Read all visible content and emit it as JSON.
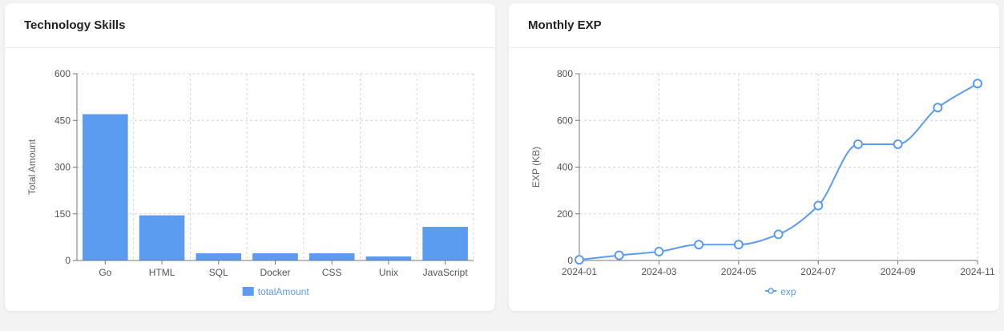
{
  "colors": {
    "accent": "#5b9cf0",
    "background": "#f3f3f3",
    "card": "#ffffff"
  },
  "cards": [
    {
      "title": "Technology Skills"
    },
    {
      "title": "Monthly EXP"
    }
  ],
  "chart_data": [
    {
      "type": "bar",
      "title": "Technology Skills",
      "categories": [
        "Go",
        "HTML",
        "SQL",
        "Docker",
        "CSS",
        "Unix",
        "JavaScript"
      ],
      "series": [
        {
          "name": "totalAmount",
          "values": [
            470,
            145,
            23,
            23,
            23,
            13,
            108
          ]
        }
      ],
      "ylabel": "Total Amount",
      "xlabel": "",
      "ylim": [
        0,
        600
      ],
      "yticks": [
        0,
        150,
        300,
        450,
        600
      ],
      "grid": true,
      "legend": "bottom-center"
    },
    {
      "type": "line",
      "title": "Monthly EXP",
      "x": [
        "2024-01",
        "2024-02",
        "2024-03",
        "2024-04",
        "2024-05",
        "2024-06",
        "2024-07",
        "2024-08",
        "2024-09",
        "2024-10",
        "2024-11"
      ],
      "xticks": [
        "2024-01",
        "2024-03",
        "2024-05",
        "2024-07",
        "2024-09",
        "2024-11"
      ],
      "series": [
        {
          "name": "exp",
          "values": [
            3,
            22,
            38,
            68,
            68,
            112,
            235,
            498,
            498,
            655,
            758
          ]
        }
      ],
      "ylabel": "EXP (KB)",
      "xlabel": "",
      "ylim": [
        0,
        800
      ],
      "yticks": [
        0,
        200,
        400,
        600,
        800
      ],
      "grid": true,
      "smooth": true,
      "legend": "bottom-center"
    }
  ]
}
